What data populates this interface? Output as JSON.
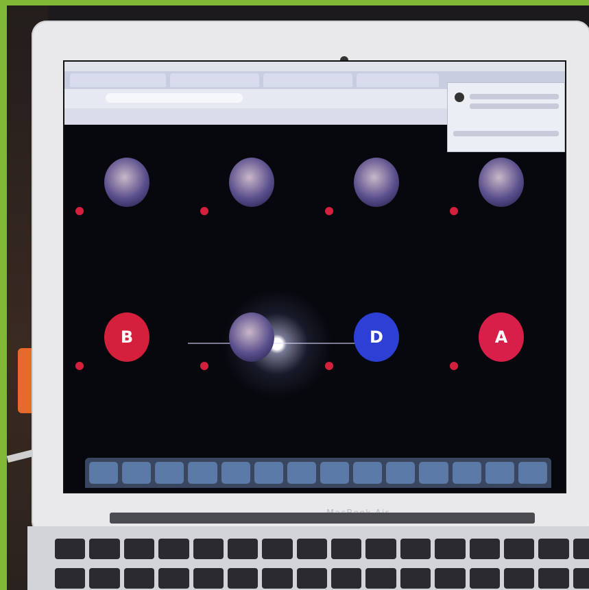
{
  "laptop": {
    "brand": "MacBook Air"
  },
  "meeting": {
    "participants": [
      {
        "initial": "",
        "color": "photo",
        "name": ""
      },
      {
        "initial": "",
        "color": "photo",
        "name": ""
      },
      {
        "initial": "",
        "color": "photo",
        "name": ""
      },
      {
        "initial": "",
        "color": "photo",
        "name": ""
      },
      {
        "initial": "B",
        "color": "#d4203d",
        "name": ""
      },
      {
        "initial": "",
        "color": "photo",
        "name": ""
      },
      {
        "initial": "D",
        "color": "#2e3fd6",
        "name": ""
      },
      {
        "initial": "A",
        "color": "#d71f49",
        "name": ""
      }
    ]
  }
}
